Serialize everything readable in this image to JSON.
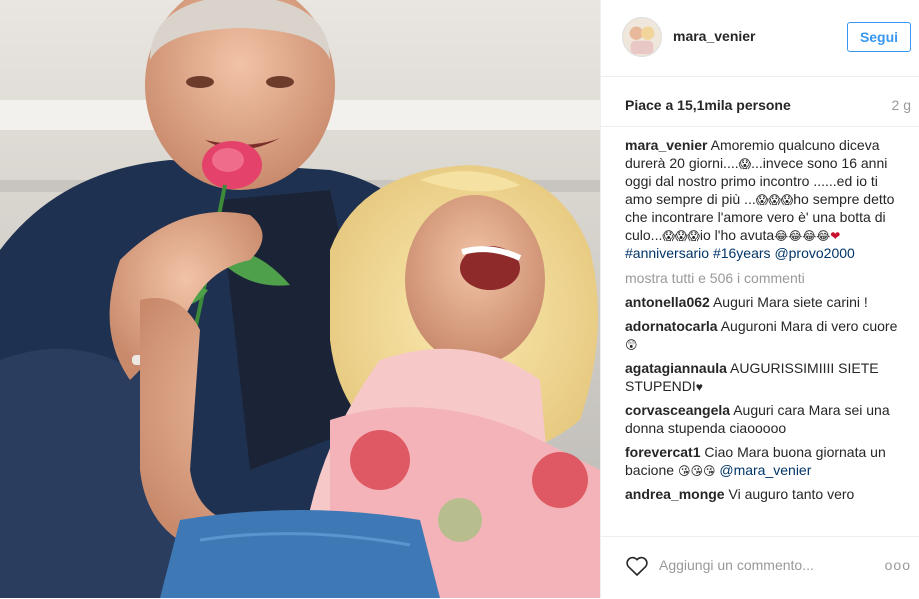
{
  "header": {
    "username": "mara_venier",
    "follow_label": "Segui"
  },
  "stats": {
    "likes_text": "Piace a 15,1mila persone",
    "age": "2 g"
  },
  "caption": {
    "username": "mara_venier",
    "text_1": "Amoremio qualcuno diceva durerà 20 giorni....",
    "text_2": "...invece sono 16 anni oggi dal nostro primo incontro ......ed io ti amo sempre di più ...",
    "text_3": "ho sempre detto che incontrare l'amore vero è' una botta di culo...",
    "text_4": "io l'ho avuta",
    "hashtag_1": "#anniversario",
    "hashtag_2": "#16years",
    "mention": "@provo2000"
  },
  "show_all": "mostra tutti e 506 i commenti",
  "comments": [
    {
      "user": "antonella062",
      "text": "Auguri Mara siete carini !"
    },
    {
      "user": "adornatocarla",
      "text": "Auguroni Mara di vero cuore"
    },
    {
      "user": "agatagiannaula",
      "text": "AUGURISSIMIIII SIETE STUPENDI"
    },
    {
      "user": "corvasceangela",
      "text": "Auguri cara Mara sei una donna stupenda ciaooooo"
    },
    {
      "user": "forevercat1",
      "text": "Ciao Mara buona giornata un bacione",
      "mention": "@mara_venier"
    },
    {
      "user": "andrea_monge",
      "text": "Vi auguro tanto vero"
    }
  ],
  "footer": {
    "comment_placeholder": "Aggiungi un commento...",
    "options": "ooo"
  },
  "colors": {
    "follow_blue": "#3897f0",
    "link_blue": "#003569",
    "muted_gray": "#999999"
  },
  "icons": [
    "heart-icon",
    "more-options-icon"
  ]
}
